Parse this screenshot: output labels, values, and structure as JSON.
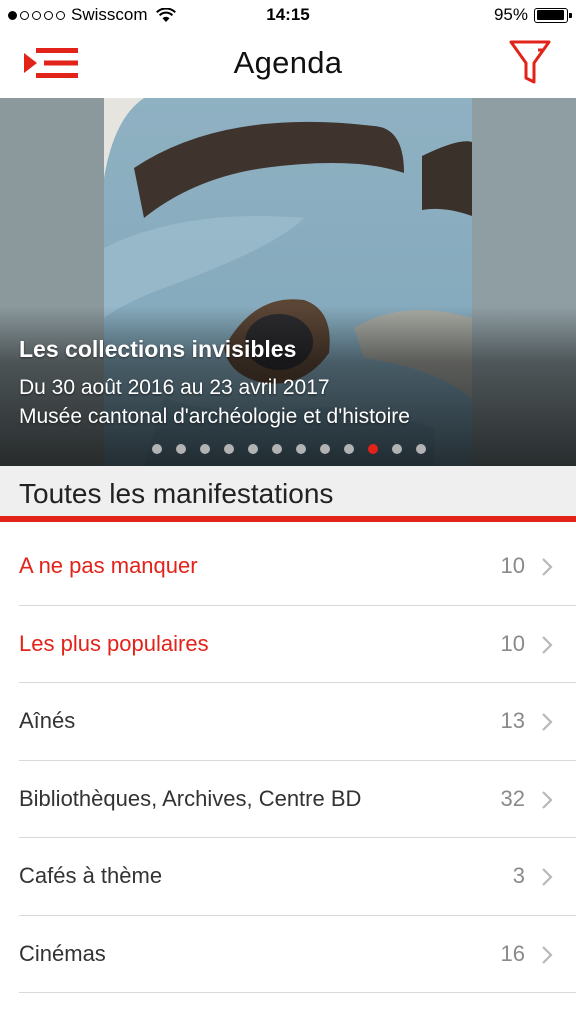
{
  "status_bar": {
    "carrier": "Swisscom",
    "time": "14:15",
    "battery": "95%",
    "battery_level": 0.95,
    "signal_bars": 1
  },
  "nav": {
    "title": "Agenda",
    "menu_icon": "menu-list-icon",
    "filter_icon": "filter-funnel-icon",
    "accent_color": "#e2231a"
  },
  "hero": {
    "title": "Les collections invisibles",
    "dates": "Du 30 août 2016 au 23 avril 2017",
    "venue": "Musée cantonal d'archéologie et d'histoire",
    "page_count": 12,
    "active_page": 10
  },
  "section": {
    "title": "Toutes les manifestations"
  },
  "categories": [
    {
      "label": "A ne pas manquer",
      "count": "10",
      "highlight": true
    },
    {
      "label": "Les plus populaires",
      "count": "10",
      "highlight": true
    },
    {
      "label": "Aînés",
      "count": "13",
      "highlight": false
    },
    {
      "label": "Bibliothèques, Archives, Centre BD",
      "count": "32",
      "highlight": false
    },
    {
      "label": "Cafés à thème",
      "count": "3",
      "highlight": false
    },
    {
      "label": "Cinémas",
      "count": "16",
      "highlight": false
    }
  ]
}
